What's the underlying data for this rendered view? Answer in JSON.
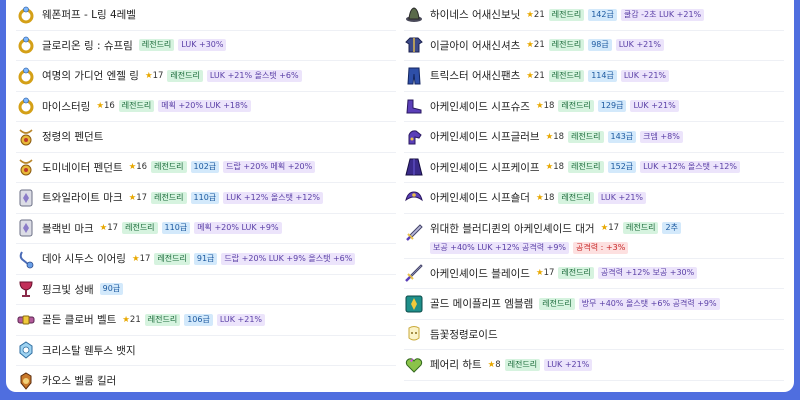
{
  "left": [
    {
      "name": "웨폰퍼프 - L링 4레벨",
      "icon": "ring-icon",
      "badges": []
    },
    {
      "name": "글로리온 링 : 슈프림",
      "icon": "ring-icon",
      "badges": [
        {
          "t": "legend",
          "v": "레전드리"
        },
        {
          "t": "stat",
          "v": "LUK +30%"
        }
      ]
    },
    {
      "name": "여명의 가디언 엔젤 링",
      "icon": "ring-icon",
      "badges": [
        {
          "t": "star",
          "v": "17"
        },
        {
          "t": "legend",
          "v": "레전드리"
        },
        {
          "t": "stat",
          "v": "LUK +21% 올스탯 +6%"
        }
      ]
    },
    {
      "name": "마이스터링",
      "icon": "ring-icon",
      "badges": [
        {
          "t": "star",
          "v": "16"
        },
        {
          "t": "legend",
          "v": "레전드리"
        },
        {
          "t": "stat",
          "v": "메획 +20% LUK +18%"
        }
      ]
    },
    {
      "name": "정령의 펜던트",
      "icon": "pendant-icon",
      "badges": []
    },
    {
      "name": "도미네이터 펜던트",
      "icon": "pendant-icon",
      "badges": [
        {
          "t": "star",
          "v": "16"
        },
        {
          "t": "legend",
          "v": "레전드리"
        },
        {
          "t": "level",
          "v": "102급"
        },
        {
          "t": "stat",
          "v": "드랍 +20% 메획 +20%"
        }
      ]
    },
    {
      "name": "트와일라이트 마크",
      "icon": "mark-icon",
      "badges": [
        {
          "t": "star",
          "v": "17"
        },
        {
          "t": "legend",
          "v": "레전드리"
        },
        {
          "t": "level",
          "v": "110급"
        },
        {
          "t": "stat",
          "v": "LUK +12% 올스탯 +12%"
        }
      ]
    },
    {
      "name": "블랙빈 마크",
      "icon": "mark-icon",
      "badges": [
        {
          "t": "star",
          "v": "17"
        },
        {
          "t": "legend",
          "v": "레전드리"
        },
        {
          "t": "level",
          "v": "110급"
        },
        {
          "t": "stat",
          "v": "메획 +20% LUK +9%"
        }
      ]
    },
    {
      "name": "데아 시두스 이어링",
      "icon": "earring-icon",
      "badges": [
        {
          "t": "star",
          "v": "17"
        },
        {
          "t": "legend",
          "v": "레전드리"
        },
        {
          "t": "level",
          "v": "91급"
        },
        {
          "t": "stat",
          "v": "드랍 +20% LUK +9% 올스탯 +6%"
        }
      ]
    },
    {
      "name": "핑크빛 성배",
      "icon": "chalice-icon",
      "badges": [
        {
          "t": "level",
          "v": "90급"
        }
      ]
    },
    {
      "name": "골든 클로버 벨트",
      "icon": "belt-icon",
      "badges": [
        {
          "t": "star",
          "v": "21"
        },
        {
          "t": "legend",
          "v": "레전드리"
        },
        {
          "t": "level",
          "v": "106급"
        },
        {
          "t": "stat",
          "v": "LUK +21%"
        }
      ]
    },
    {
      "name": "크리스탈 웬투스 뱃지",
      "icon": "badge-icon",
      "badges": []
    },
    {
      "name": "카오스 벨룸 킬러",
      "icon": "medal-icon",
      "badges": []
    }
  ],
  "right": [
    {
      "name": "하이네스 어새신보닛",
      "icon": "hat-icon",
      "badges": [
        {
          "t": "star",
          "v": "21"
        },
        {
          "t": "legend",
          "v": "레전드리"
        },
        {
          "t": "level",
          "v": "142급"
        },
        {
          "t": "stat",
          "v": "쿨감 -2초 LUK +21%"
        }
      ]
    },
    {
      "name": "이글아이 어새신셔츠",
      "icon": "shirt-icon",
      "badges": [
        {
          "t": "star",
          "v": "21"
        },
        {
          "t": "legend",
          "v": "레전드리"
        },
        {
          "t": "level",
          "v": "98급"
        },
        {
          "t": "stat",
          "v": "LUK +21%"
        }
      ]
    },
    {
      "name": "트릭스터 어새신팬츠",
      "icon": "pants-icon",
      "badges": [
        {
          "t": "star",
          "v": "21"
        },
        {
          "t": "legend",
          "v": "레전드리"
        },
        {
          "t": "level",
          "v": "114급"
        },
        {
          "t": "stat",
          "v": "LUK +21%"
        }
      ]
    },
    {
      "name": "아케인셰이드 시프슈즈",
      "icon": "shoes-icon",
      "badges": [
        {
          "t": "star",
          "v": "18"
        },
        {
          "t": "legend",
          "v": "레전드리"
        },
        {
          "t": "level",
          "v": "129급"
        },
        {
          "t": "stat",
          "v": "LUK +21%"
        }
      ]
    },
    {
      "name": "아케인셰이드 시프글러브",
      "icon": "glove-icon",
      "badges": [
        {
          "t": "star",
          "v": "18"
        },
        {
          "t": "legend",
          "v": "레전드리"
        },
        {
          "t": "level",
          "v": "143급"
        },
        {
          "t": "stat",
          "v": "크뎀 +8%"
        }
      ]
    },
    {
      "name": "아케인셰이드 시프케이프",
      "icon": "cape-icon",
      "badges": [
        {
          "t": "star",
          "v": "18"
        },
        {
          "t": "legend",
          "v": "레전드리"
        },
        {
          "t": "level",
          "v": "152급"
        },
        {
          "t": "stat",
          "v": "LUK +12% 올스탯 +12%"
        }
      ]
    },
    {
      "name": "아케인셰이드 시프숄더",
      "icon": "shoulder-icon",
      "badges": [
        {
          "t": "star",
          "v": "18"
        },
        {
          "t": "legend",
          "v": "레전드리"
        },
        {
          "t": "stat",
          "v": "LUK +21%"
        }
      ]
    },
    {
      "name": "위대한 블러디퀸의 아케인셰이드 대거",
      "icon": "dagger-icon",
      "tall": true,
      "badges": [
        {
          "t": "star",
          "v": "17"
        },
        {
          "t": "legend",
          "v": "레전드리"
        },
        {
          "t": "level",
          "v": "2추"
        },
        {
          "t": "br",
          "v": ""
        },
        {
          "t": "stat",
          "v": "보공 +40% LUK +12% 공격력 +9%"
        },
        {
          "t": "warn",
          "v": "공격력 : +3%"
        }
      ]
    },
    {
      "name": "아케인셰이드 블레이드",
      "icon": "blade-icon",
      "badges": [
        {
          "t": "star",
          "v": "17"
        },
        {
          "t": "legend",
          "v": "레전드리"
        },
        {
          "t": "stat",
          "v": "공격력 +12% 보공 +30%"
        }
      ]
    },
    {
      "name": "골드 메이플리프 엠블렘",
      "icon": "emblem-icon",
      "badges": [
        {
          "t": "legend",
          "v": "레전드리"
        },
        {
          "t": "stat",
          "v": "방무 +40% 올스탯 +6% 공격력 +9%"
        }
      ]
    },
    {
      "name": "듬꽃정령로이드",
      "icon": "android-icon",
      "badges": []
    },
    {
      "name": "페어리 하트",
      "icon": "heart-icon",
      "badges": [
        {
          "t": "star",
          "v": "8"
        },
        {
          "t": "legend",
          "v": "레전드리"
        },
        {
          "t": "stat",
          "v": "LUK +21%"
        }
      ]
    }
  ],
  "colors": {
    "background": "#4F6EDF",
    "card": "#ffffff",
    "star": "#e8a800"
  }
}
